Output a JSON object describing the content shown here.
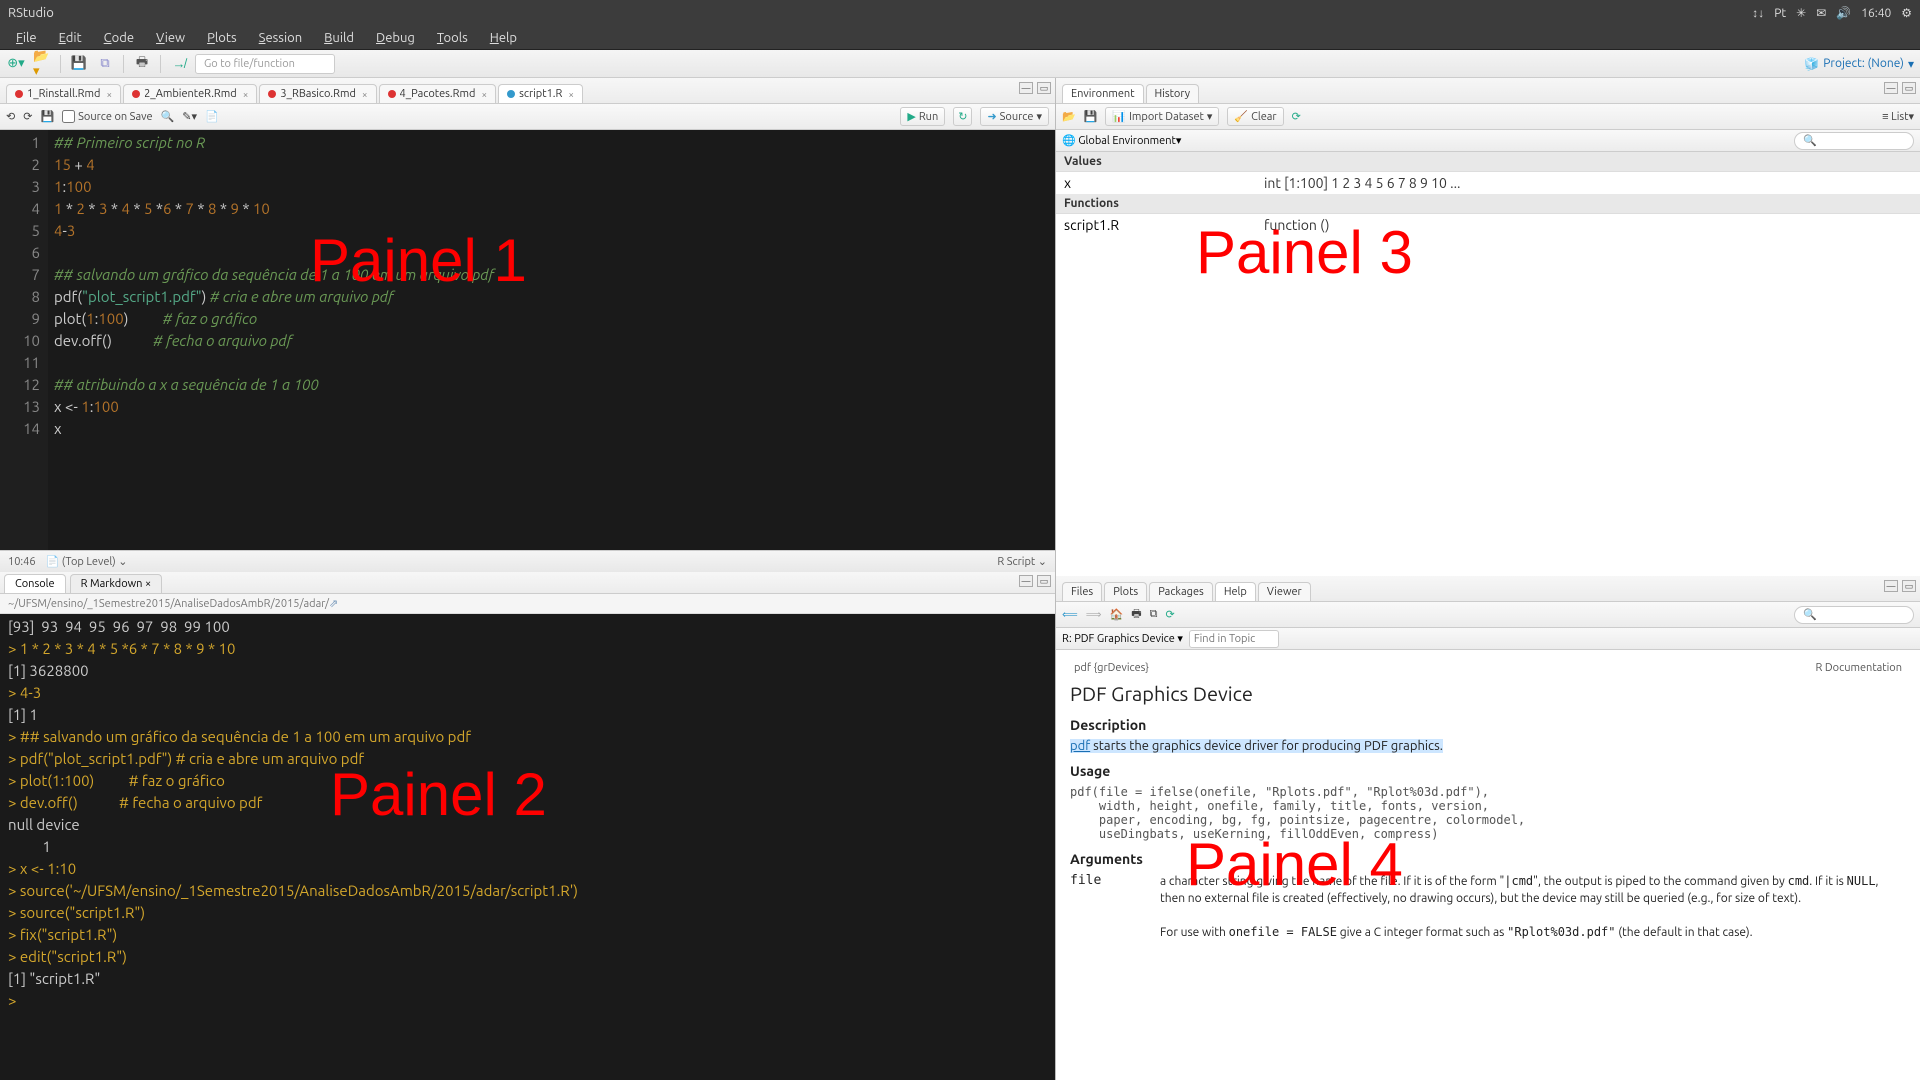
{
  "system": {
    "title": "RStudio",
    "clock": "16:40",
    "tray": [
      "↕↓",
      "Pt",
      "✳",
      "✉",
      "🔊"
    ]
  },
  "menu": [
    "File",
    "Edit",
    "Code",
    "View",
    "Plots",
    "Session",
    "Build",
    "Debug",
    "Tools",
    "Help"
  ],
  "toolbar": {
    "goto_placeholder": "Go to file/function",
    "project_label": "Project: (None)"
  },
  "source": {
    "tabs": [
      {
        "label": "1_Rinstall.Rmd",
        "active": false
      },
      {
        "label": "2_AmbienteR.Rmd",
        "active": false
      },
      {
        "label": "3_RBasico.Rmd",
        "active": false
      },
      {
        "label": "4_Pacotes.Rmd",
        "active": false
      },
      {
        "label": "script1.R",
        "active": true
      }
    ],
    "source_on_save": "Source on Save",
    "run_label": "Run",
    "source_label": "Source",
    "status_pos": "10:46",
    "status_scope": "(Top Level)",
    "status_lang": "R Script",
    "code_lines": [
      {
        "n": 1,
        "html": "<span class='cm-comment'>## Primeiro script no R</span>"
      },
      {
        "n": 2,
        "html": "<span class='cm-num'>15</span> <span class='cm-op'>+</span> <span class='cm-num'>4</span>"
      },
      {
        "n": 3,
        "html": "<span class='cm-num'>1</span><span class='cm-op'>:</span><span class='cm-num'>100</span>"
      },
      {
        "n": 4,
        "html": "<span class='cm-num'>1</span> <span class='cm-op'>*</span> <span class='cm-num'>2</span> <span class='cm-op'>*</span> <span class='cm-num'>3</span> <span class='cm-op'>*</span> <span class='cm-num'>4</span> <span class='cm-op'>*</span> <span class='cm-num'>5</span> <span class='cm-op'>*</span><span class='cm-num'>6</span> <span class='cm-op'>*</span> <span class='cm-num'>7</span> <span class='cm-op'>*</span> <span class='cm-num'>8</span> <span class='cm-op'>*</span> <span class='cm-num'>9</span> <span class='cm-op'>*</span> <span class='cm-num'>10</span>"
      },
      {
        "n": 5,
        "html": "<span class='cm-num'>4</span><span class='cm-op'>-</span><span class='cm-num'>3</span>"
      },
      {
        "n": 6,
        "html": ""
      },
      {
        "n": 7,
        "html": "<span class='cm-comment'>## salvando um gráfico da sequência de 1 a 100 em um arquivo pdf</span>"
      },
      {
        "n": 8,
        "html": "<span class='cm-fn'>pdf</span>(<span class='cm-str'>\"plot_script1.pdf\"</span>) <span class='cm-comment'># cria e abre um arquivo pdf</span>"
      },
      {
        "n": 9,
        "html": "<span class='cm-fn'>plot</span>(<span class='cm-num'>1</span><span class='cm-op'>:</span><span class='cm-num'>100</span>)          <span class='cm-comment'># faz o gráfico</span>"
      },
      {
        "n": 10,
        "html": "<span class='cm-fn'>dev.off</span>()            <span class='cm-comment'># fecha o arquivo pdf</span>"
      },
      {
        "n": 11,
        "html": ""
      },
      {
        "n": 12,
        "html": "<span class='cm-comment'>## atribuindo a x a sequência de 1 a 100</span>"
      },
      {
        "n": 13,
        "html": "x <span class='cm-op'>&lt;-</span> <span class='cm-num'>1</span><span class='cm-op'>:</span><span class='cm-num'>100</span>"
      },
      {
        "n": 14,
        "html": "x"
      }
    ]
  },
  "console": {
    "tabs": [
      "Console",
      "R Markdown"
    ],
    "path": "~/UFSM/ensino/_1Semestre2015/AnaliseDadosAmbR/2015/adar/",
    "lines": [
      {
        "t": "out",
        "s": "[93]  93  94  95  96  97  98  99 100"
      },
      {
        "t": "in",
        "s": "1 * 2 * 3 * 4 * 5 *6 * 7 * 8 * 9 * 10"
      },
      {
        "t": "out",
        "s": "[1] 3628800"
      },
      {
        "t": "in",
        "s": "4-3"
      },
      {
        "t": "out",
        "s": "[1] 1"
      },
      {
        "t": "in",
        "s": "## salvando um gráfico da sequência de 1 a 100 em um arquivo pdf"
      },
      {
        "t": "in",
        "s": "pdf(\"plot_script1.pdf\") # cria e abre um arquivo pdf"
      },
      {
        "t": "in",
        "s": "plot(1:100)          # faz o gráfico"
      },
      {
        "t": "in",
        "s": "dev.off()            # fecha o arquivo pdf"
      },
      {
        "t": "out",
        "s": "null device"
      },
      {
        "t": "out",
        "s": "          1"
      },
      {
        "t": "in",
        "s": "x <- 1:10"
      },
      {
        "t": "in",
        "s": "source('~/UFSM/ensino/_1Semestre2015/AnaliseDadosAmbR/2015/adar/script1.R')"
      },
      {
        "t": "in",
        "s": "source(\"script1.R\")"
      },
      {
        "t": "in",
        "s": "fix(\"script1.R\")"
      },
      {
        "t": "in",
        "s": "edit(\"script1.R\")"
      },
      {
        "t": "out",
        "s": "[1] \"script1.R\""
      },
      {
        "t": "in",
        "s": ""
      }
    ]
  },
  "environment": {
    "tabs": [
      "Environment",
      "History"
    ],
    "import_label": "Import Dataset",
    "clear_label": "Clear",
    "list_label": "List",
    "scope": "Global Environment",
    "sections": [
      {
        "title": "Values",
        "rows": [
          {
            "k": "x",
            "v": "int [1:100] 1 2 3 4 5 6 7 8 9 10 ..."
          }
        ]
      },
      {
        "title": "Functions",
        "rows": [
          {
            "k": "script1.R",
            "v": "function ()"
          }
        ]
      }
    ]
  },
  "helppane": {
    "tabs": [
      "Files",
      "Plots",
      "Packages",
      "Help",
      "Viewer"
    ],
    "active_tab": "Help",
    "breadcrumb": "R: PDF Graphics Device",
    "find_placeholder": "Find in Topic",
    "pkg_line_left": "pdf {grDevices}",
    "pkg_line_right": "R Documentation",
    "title": "PDF Graphics Device",
    "desc_label": "Description",
    "desc_text": "starts the graphics device driver for producing PDF graphics.",
    "desc_link": "pdf",
    "usage_label": "Usage",
    "usage_code": "pdf(file = ifelse(onefile, \"Rplots.pdf\", \"Rplot%03d.pdf\"),\n    width, height, onefile, family, title, fonts, version,\n    paper, encoding, bg, fg, pointsize, pagecentre, colormodel,\n    useDingbats, useKerning, fillOddEven, compress)",
    "args_label": "Arguments",
    "arg_file_name": "file",
    "arg_file_desc1_a": "a character string giving the name of the file. If it is of the form \"",
    "arg_file_desc1_b": "|cmd",
    "arg_file_desc1_c": "\", the output is piped to the command given by ",
    "arg_file_desc1_d": "cmd",
    "arg_file_desc1_e": ". If it is ",
    "arg_file_desc1_f": "NULL",
    "arg_file_desc1_g": ", then no external file is created (effectively, no drawing occurs), but the device may still be queried (e.g., for size of text).",
    "arg_file_desc2_a": "For use with ",
    "arg_file_desc2_b": "onefile = FALSE",
    "arg_file_desc2_c": " give a C integer format such as ",
    "arg_file_desc2_d": "\"Rplot%03d.pdf\"",
    "arg_file_desc2_e": " (the default in that case)."
  },
  "overlays": {
    "p1": "Painel 1",
    "p2": "Painel 2",
    "p3": "Painel 3",
    "p4": "Painel 4"
  }
}
